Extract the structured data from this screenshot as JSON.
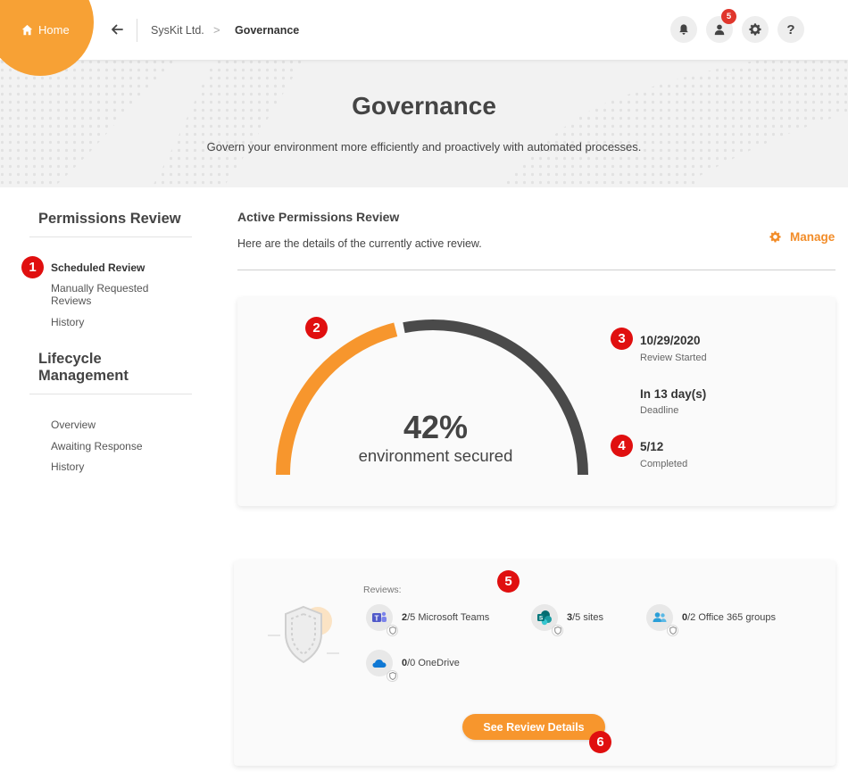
{
  "topbar": {
    "home_label": "Home",
    "breadcrumb": [
      "SysKit Ltd.",
      "Governance"
    ],
    "breadcrumb_separator": ">",
    "notification_count": "5",
    "help_label": "?"
  },
  "hero": {
    "title": "Governance",
    "subtitle": "Govern your environment more efficiently and proactively with automated processes."
  },
  "sidebar": {
    "section1_title": "Permissions Review",
    "section1_items": [
      "Scheduled Review",
      "Manually Requested Reviews",
      "History"
    ],
    "section2_title": "Lifecycle Management",
    "section2_items": [
      "Overview",
      "Awaiting Response",
      "History"
    ]
  },
  "main": {
    "title": "Active Permissions Review",
    "subtitle": "Here are the details of the currently active review.",
    "manage_label": "Manage"
  },
  "progress": {
    "percent_label": "42%",
    "percent_value": 0.42,
    "caption": "environment secured",
    "stats": [
      {
        "value": "10/29/2020",
        "label": "Review Started"
      },
      {
        "value": "In 13 day(s)",
        "label": "Deadline"
      },
      {
        "value": "5/12",
        "label": "Completed"
      }
    ]
  },
  "reviews": {
    "heading": "Reviews:",
    "items": [
      {
        "done": "2",
        "rest": "/5 Microsoft Teams",
        "icon": "teams-icon"
      },
      {
        "done": "3",
        "rest": "/5 sites",
        "icon": "sharepoint-icon"
      },
      {
        "done": "0",
        "rest": "/2 Office 365 groups",
        "icon": "groups-icon"
      },
      {
        "done": "0",
        "rest": "/0 OneDrive",
        "icon": "onedrive-icon"
      }
    ],
    "cta_label": "See Review Details"
  },
  "annotations": [
    "1",
    "2",
    "3",
    "4",
    "5",
    "6"
  ],
  "colors": {
    "accent": "#f7a135",
    "gauge_dark": "#4a4a4a",
    "annotation_red": "#e00f0f",
    "badge_red": "#e0362c"
  }
}
